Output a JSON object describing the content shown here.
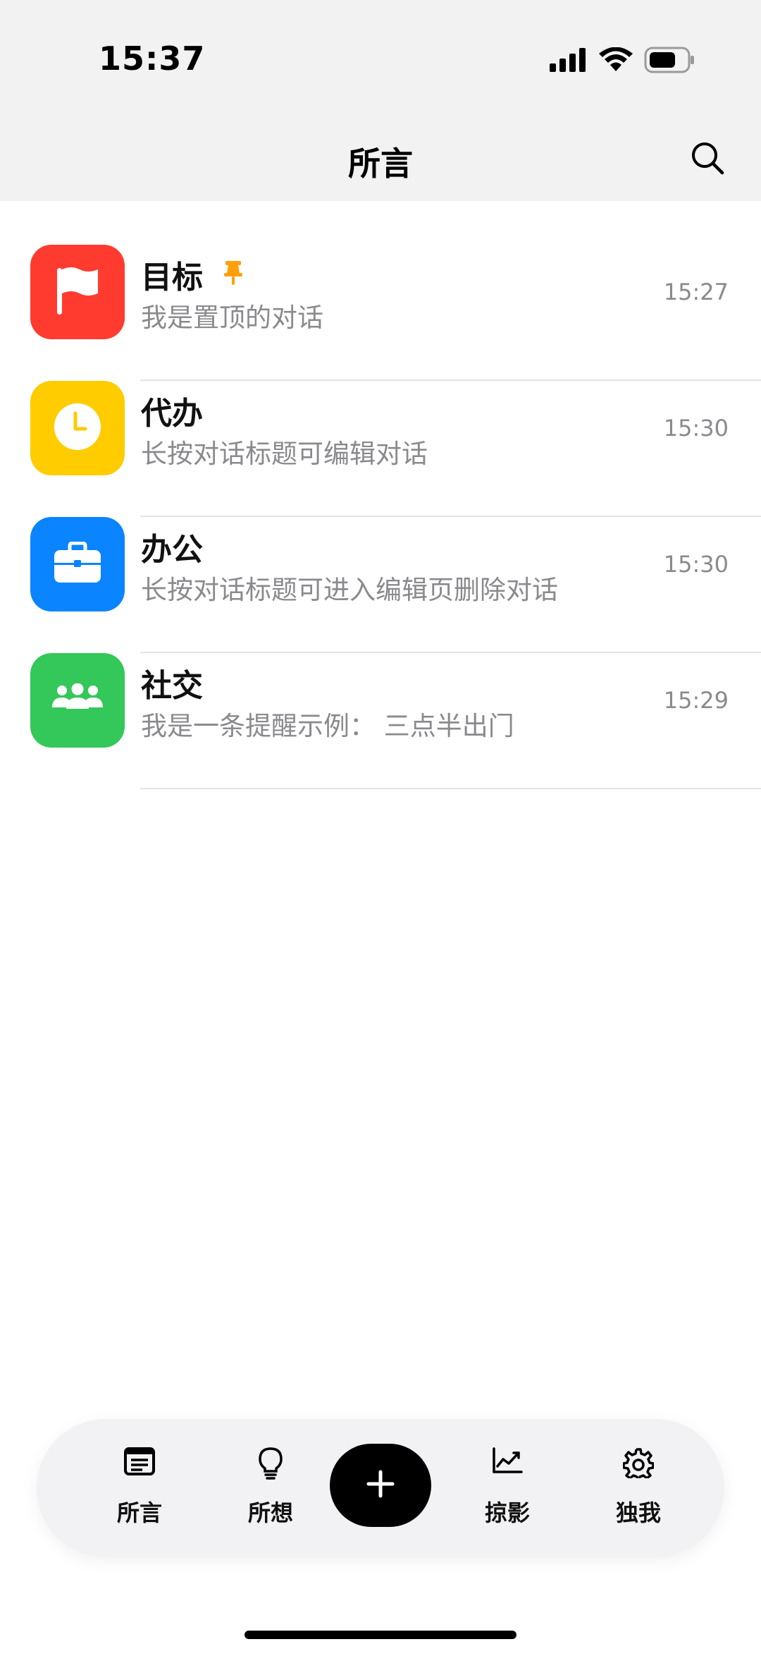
{
  "status_bar": {
    "time": "15:37"
  },
  "header": {
    "title": "所言"
  },
  "conversations": [
    {
      "title": "目标",
      "subtitle": "我是置顶的对话",
      "time": "15:27",
      "icon": "flag-icon",
      "color": "#FF3B30",
      "pinned": true
    },
    {
      "title": "代办",
      "subtitle": "长按对话标题可编辑对话",
      "time": "15:30",
      "icon": "clock-icon",
      "color": "#FFCC00",
      "pinned": false
    },
    {
      "title": "办公",
      "subtitle": "长按对话标题可进入编辑页删除对话",
      "time": "15:30",
      "icon": "briefcase-icon",
      "color": "#0A84FF",
      "pinned": false
    },
    {
      "title": "社交",
      "subtitle": "我是一条提醒示例： 三点半出门",
      "time": "15:29",
      "icon": "people-icon",
      "color": "#34C759",
      "pinned": false
    }
  ],
  "tabbar": {
    "tabs": [
      {
        "label": "所言",
        "icon": "document-icon"
      },
      {
        "label": "所想",
        "icon": "lightbulb-icon"
      },
      {
        "label": "掠影",
        "icon": "chart-icon"
      },
      {
        "label": "独我",
        "icon": "gear-icon"
      }
    ],
    "add_icon": "plus-icon"
  },
  "colors": {
    "pin": "#FF9F0A",
    "secondary_text": "#8A8A8E"
  }
}
